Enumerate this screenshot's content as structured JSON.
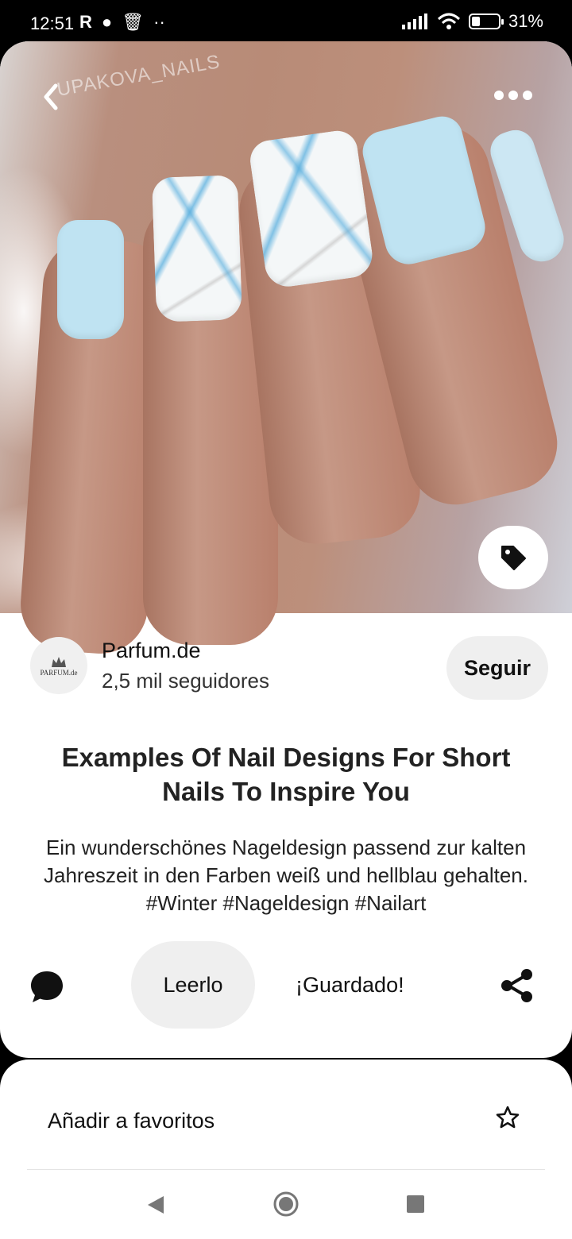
{
  "status_bar": {
    "time": "12:51",
    "battery": "31%",
    "battery_level": 0.31
  },
  "pin": {
    "watermark": "UPAKOVA_NAILS",
    "creator": {
      "name": "Parfum.de",
      "followers": "2,5 mil seguidores",
      "avatar_text": "PARFUM.de"
    },
    "follow_label": "Seguir",
    "title": "Examples Of Nail Designs For Short Nails To Inspire You",
    "description": "Ein wunderschönes Nageldesign  passend zur kalten Jahreszeit in den Farben weiß und hellblau gehalten.  #Winter #Nageldesign #Nailart"
  },
  "actions": {
    "read_label": "Leerlo",
    "saved_label": "¡Guardado!"
  },
  "sheet": {
    "favorite_label": "Añadir a favoritos"
  },
  "icons": {
    "back": "chevron-left-icon",
    "more": "more-horizontal-icon",
    "tag": "tag-icon",
    "comment": "comment-icon",
    "share": "share-icon",
    "favorite": "star-outline-icon"
  },
  "colors": {
    "button_bg": "#efefef",
    "nail_blue": "#bfe3f2",
    "text": "#111111"
  }
}
